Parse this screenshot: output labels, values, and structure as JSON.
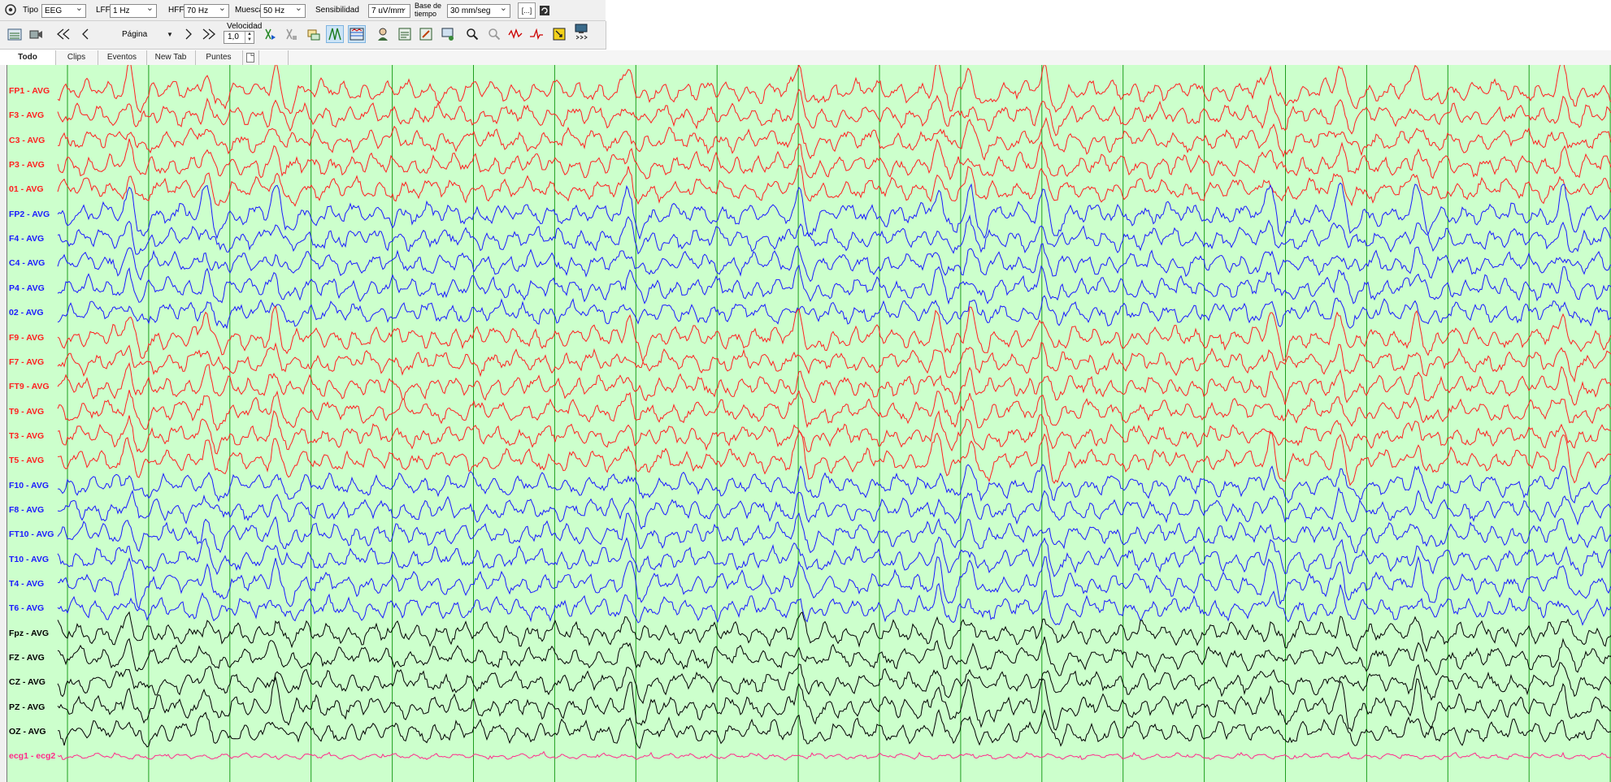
{
  "toolbar": {
    "tipo_label": "Tipo",
    "tipo_value": "EEG",
    "lff_label": "LFF",
    "lff_value": "1 Hz",
    "hff_label": "HFF",
    "hff_value": "70 Hz",
    "muesca_label": "Muesca",
    "muesca_value": "50 Hz",
    "sensibilidad_label": "Sensibilidad",
    "sensibilidad_value": "7 uV/mm",
    "base_tiempo_label_1": "Base de",
    "base_tiempo_label_2": "tiempo",
    "base_tiempo_value": "30 mm/seg",
    "bracket_button": "[...]",
    "pagina_label": "Página",
    "velocidad_label": "Velocidad",
    "velocidad_value": "1,0"
  },
  "tabs": [
    {
      "label": "Todo",
      "active": true
    },
    {
      "label": "Clips",
      "active": false
    },
    {
      "label": "Eventos",
      "active": false
    },
    {
      "label": "New Tab",
      "active": false
    },
    {
      "label": "Puntes",
      "active": false
    }
  ],
  "channels": [
    {
      "label": "FP1 - AVG",
      "color": "#ff2020"
    },
    {
      "label": "F3 - AVG",
      "color": "#ff2020"
    },
    {
      "label": "C3 - AVG",
      "color": "#ff2020"
    },
    {
      "label": "P3 - AVG",
      "color": "#ff2020"
    },
    {
      "label": "01 - AVG",
      "color": "#ff2020"
    },
    {
      "label": "FP2 - AVG",
      "color": "#1a1aff"
    },
    {
      "label": "F4 - AVG",
      "color": "#1a1aff"
    },
    {
      "label": "C4 - AVG",
      "color": "#1a1aff"
    },
    {
      "label": "P4 - AVG",
      "color": "#1a1aff"
    },
    {
      "label": "02 - AVG",
      "color": "#1a1aff"
    },
    {
      "label": "F9 - AVG",
      "color": "#ff2020"
    },
    {
      "label": "F7 - AVG",
      "color": "#ff2020"
    },
    {
      "label": "FT9 - AVG",
      "color": "#ff2020"
    },
    {
      "label": "T9 - AVG",
      "color": "#ff2020"
    },
    {
      "label": "T3 - AVG",
      "color": "#ff2020"
    },
    {
      "label": "T5 - AVG",
      "color": "#ff2020"
    },
    {
      "label": "F10 - AVG",
      "color": "#1a1aff"
    },
    {
      "label": "F8 - AVG",
      "color": "#1a1aff"
    },
    {
      "label": "FT10 - AVG",
      "color": "#1a1aff"
    },
    {
      "label": "T10 - AVG",
      "color": "#1a1aff"
    },
    {
      "label": "T4 - AVG",
      "color": "#1a1aff"
    },
    {
      "label": "T6 - AVG",
      "color": "#1a1aff"
    },
    {
      "label": "Fpz - AVG",
      "color": "#000000"
    },
    {
      "label": "FZ - AVG",
      "color": "#000000"
    },
    {
      "label": "CZ - AVG",
      "color": "#000000"
    },
    {
      "label": "PZ - AVG",
      "color": "#000000"
    },
    {
      "label": "OZ - AVG",
      "color": "#000000"
    },
    {
      "label": "ecg1 - ecg2",
      "color": "#ff2a8a"
    }
  ],
  "colors": {
    "viewer_bg": "#ccffcc",
    "second_grid": "#1e9e1e",
    "left_hemisphere": "#ff2020",
    "right_hemisphere": "#1a1aff",
    "midline": "#000000",
    "ecg": "#ff2a8a"
  },
  "icons": [
    "settings-icon",
    "montage-icon",
    "video-icon",
    "rewind-icon",
    "step-back-icon",
    "step-forward-icon",
    "fast-forward-icon",
    "marker-icon",
    "ruler-icon",
    "link-icon",
    "waveform-pressed-icon",
    "grid-pressed-icon",
    "person-icon",
    "report-icon",
    "edit-icon",
    "network-icon",
    "zoom-in-icon",
    "zoom-out-icon",
    "filter-icon",
    "spike-icon",
    "note-icon",
    "computer-icon"
  ]
}
